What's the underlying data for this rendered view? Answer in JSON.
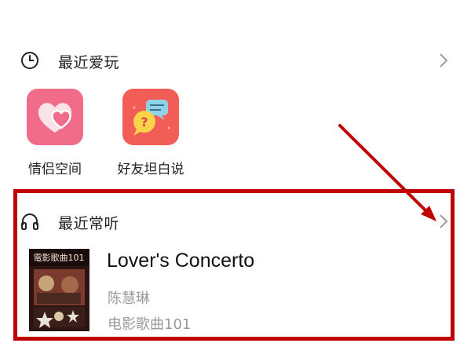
{
  "recent_play": {
    "title": "最近爱玩",
    "apps": [
      {
        "label": "情侣空间",
        "icon": "hearts-icon",
        "color": "#f06c89"
      },
      {
        "label": "好友坦白说",
        "icon": "chat-bubbles-icon",
        "color": "#f25d58"
      }
    ]
  },
  "recent_listen": {
    "title": "最近常听",
    "song": {
      "title": "Lover's Concerto",
      "artist": "陈慧琳",
      "album": "电影歌曲101",
      "cover_text": "電影歌曲101"
    }
  },
  "colors": {
    "highlight": "#c00000",
    "arrow": "#c00000",
    "subtext": "#9a9a9a"
  }
}
